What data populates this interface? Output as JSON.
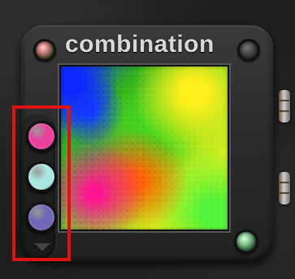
{
  "widget": {
    "title": "combination"
  },
  "controls": {
    "swatches": [
      {
        "name": "pink",
        "color": "#ea3f9d"
      },
      {
        "name": "cyan",
        "color": "#a8e7e2"
      },
      {
        "name": "purple",
        "color": "#6f67b7"
      }
    ],
    "arrow": "down-arrow-icon"
  },
  "knobs": {
    "top_left": "knob-icon",
    "top_right": "knob-icon",
    "bottom_right": "knob-icon"
  },
  "highlight": {
    "color": "#e01212"
  }
}
